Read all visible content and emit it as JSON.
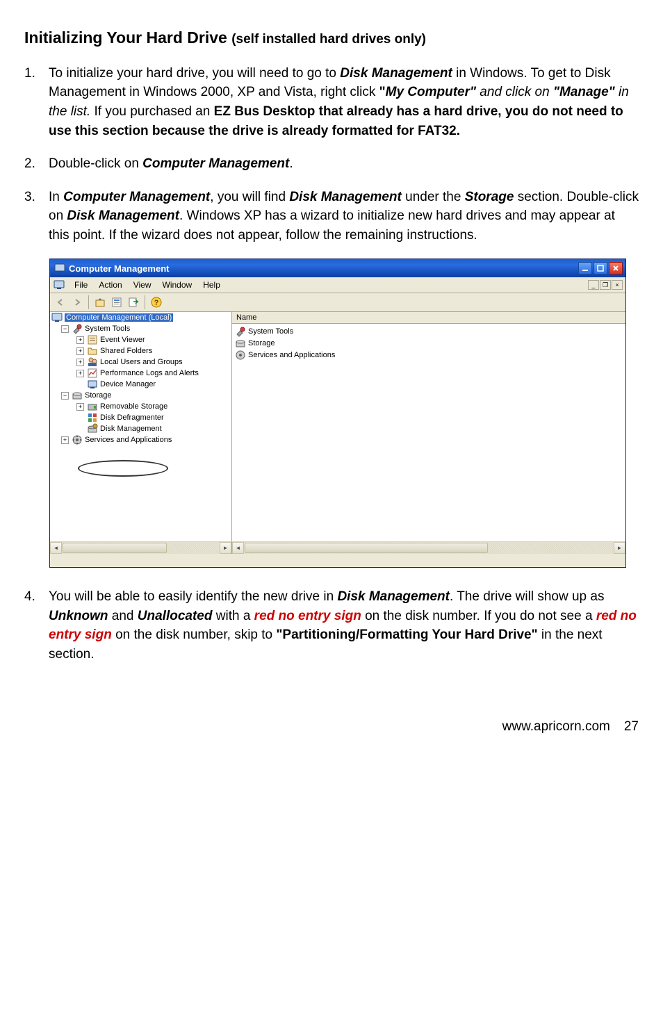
{
  "heading": {
    "main": "Initializing Your Hard Drive ",
    "sub": "(self installed hard drives only)"
  },
  "step1": {
    "num": "1.",
    "t1": "To initialize your hard drive, you will need to go to ",
    "bi1": "Disk Management",
    "t2": " in Windows.  To get to Disk Management in Windows 2000, XP and Vista, right click ",
    "b1": "\"",
    "bi2": "My Computer\"",
    "i1": " and click on ",
    "bi3": "\"Manage\"",
    "i2": " in the list.",
    "t3": " If you purchased an ",
    "b2": "EZ Bus Desktop that already has a hard drive, you do not need to use this section because the drive is already formatted for FAT32."
  },
  "step2": {
    "num": "2.",
    "t1": "Double-click on ",
    "bi1": "Computer Management",
    "t2": "."
  },
  "step3": {
    "num": "3.",
    "t1": "In ",
    "bi1": "Computer Management",
    "t2": ", you will find ",
    "bi2": "Disk Management",
    "t3": " under the ",
    "bi3": "Storage",
    "t4": " section. Double-click on ",
    "bi4": "Disk Management",
    "t5": ".  Windows XP has a wizard to initialize new hard drives and may appear at this point.  If the wizard does not appear, follow the remaining instructions."
  },
  "step4": {
    "num": "4.",
    "t1": "You will be able to easily identify the new drive in ",
    "bi1": "Disk Management",
    "t2": ".  The drive will show up as ",
    "bi2": "Unknown",
    "t3": " and ",
    "bi3": "Unallocated",
    "t4": " with a ",
    "r1": "red no entry sign",
    "t5": " on the disk number.  If you do not see a ",
    "r2": "red no entry sign",
    "t6": " on the disk number, skip to ",
    "b1": "\"Partitioning/Formatting Your Hard Drive\"",
    "t7": " in the next section."
  },
  "window": {
    "title": "Computer Management",
    "menus": {
      "file": "File",
      "action": "Action",
      "view": "View",
      "window": "Window",
      "help": "Help"
    },
    "col_name": "Name",
    "tree": {
      "root": "Computer Management (Local)",
      "system_tools": "System Tools",
      "event_viewer": "Event Viewer",
      "shared_folders": "Shared Folders",
      "local_users": "Local Users and Groups",
      "perf_logs": "Performance Logs and Alerts",
      "device_manager": "Device Manager",
      "storage": "Storage",
      "removable": "Removable Storage",
      "defrag": "Disk Defragmenter",
      "disk_mgmt": "Disk Management",
      "services": "Services and Applications"
    },
    "list": {
      "system_tools": "System Tools",
      "storage": "Storage",
      "services": "Services and Applications"
    }
  },
  "footer": {
    "url": "www.apricorn.com",
    "page": "27"
  }
}
